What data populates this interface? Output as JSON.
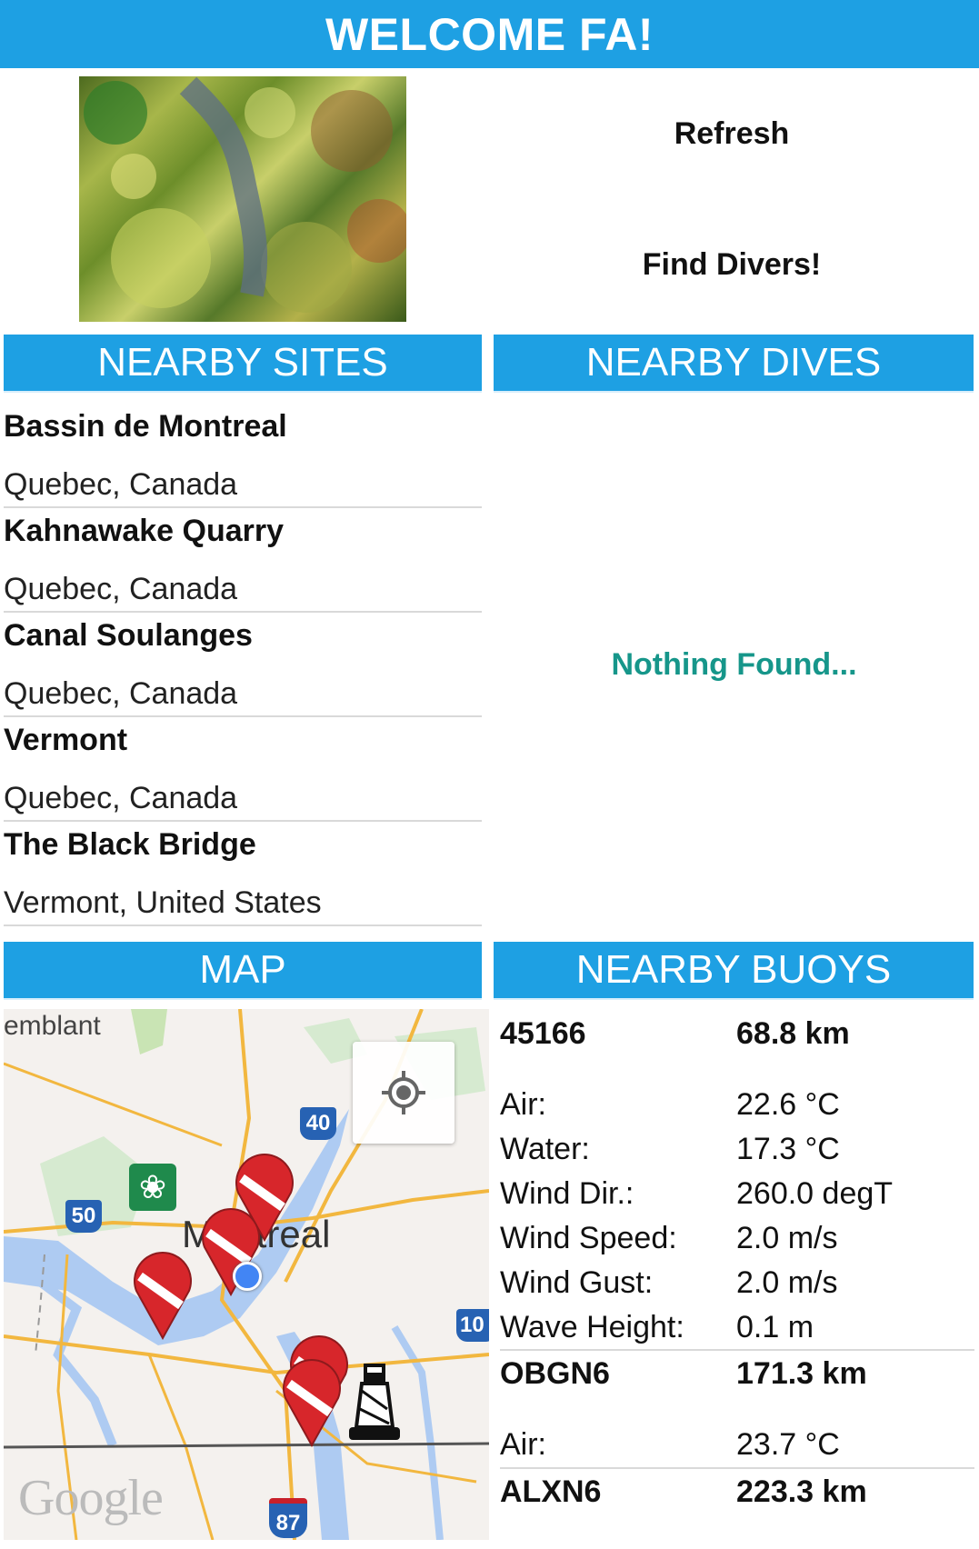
{
  "header": {
    "title": "WELCOME FA!"
  },
  "actions": {
    "refresh_label": "Refresh",
    "find_divers_label": "Find Divers!"
  },
  "sections": {
    "nearby_sites": "NEARBY SITES",
    "nearby_dives": "NEARBY DIVES",
    "map": "MAP",
    "nearby_buoys": "NEARBY BUOYS"
  },
  "sites": [
    {
      "name": "Bassin de Montreal",
      "location": "Quebec, Canada"
    },
    {
      "name": "Kahnawake Quarry",
      "location": "Quebec, Canada"
    },
    {
      "name": "Canal Soulanges",
      "location": "Quebec, Canada"
    },
    {
      "name": "Vermont",
      "location": "Quebec, Canada"
    },
    {
      "name": "The Black Bridge",
      "location": "Vermont, United States"
    }
  ],
  "dives": {
    "empty_text": "Nothing Found..."
  },
  "map": {
    "labels": {
      "place_tremblant": "emblant",
      "place_montreal": "Montreal",
      "google": "Google"
    },
    "shields": {
      "hwy40": "40",
      "hwy50": "50",
      "hwy10": "10",
      "i87": "87"
    },
    "icons": [
      "my-location-icon",
      "dive-flag-marker-icon",
      "buoy-icon",
      "park-leaf-icon",
      "user-location-dot"
    ]
  },
  "buoys": [
    {
      "id": "45166",
      "distance": "68.8 km",
      "readings": [
        {
          "label": "Air:",
          "value": "22.6 °C"
        },
        {
          "label": "Water:",
          "value": "17.3 °C"
        },
        {
          "label": "Wind Dir.:",
          "value": "260.0 degT"
        },
        {
          "label": "Wind Speed:",
          "value": "2.0 m/s"
        },
        {
          "label": "Wind Gust:",
          "value": "2.0 m/s"
        },
        {
          "label": "Wave Height:",
          "value": "0.1 m"
        }
      ]
    },
    {
      "id": "OBGN6",
      "distance": "171.3 km",
      "readings": [
        {
          "label": "Air:",
          "value": "23.7 °C"
        }
      ]
    },
    {
      "id": "ALXN6",
      "distance": "223.3 km",
      "readings": []
    }
  ],
  "colors": {
    "accent": "#1ea0e3",
    "empty_text": "#16968a",
    "dive_flag_red": "#d7262b"
  }
}
